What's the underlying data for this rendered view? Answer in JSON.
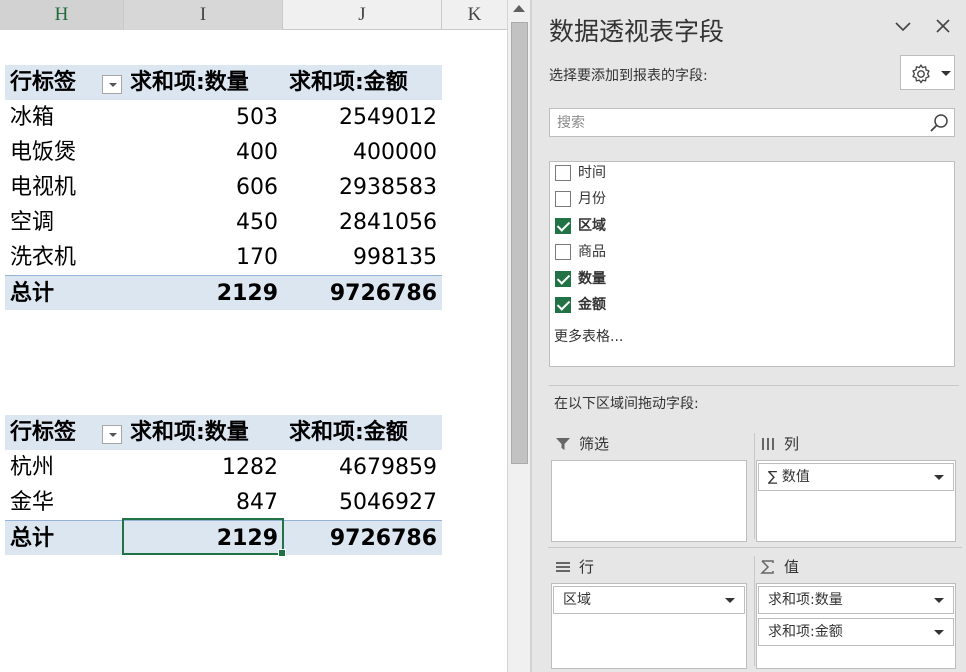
{
  "sheet": {
    "columns": [
      {
        "label": "H",
        "state": "normal"
      },
      {
        "label": "I",
        "state": "active"
      },
      {
        "label": "J",
        "state": "normal"
      },
      {
        "label": "K",
        "state": "normal"
      }
    ],
    "pivot1": {
      "headers": [
        "行标签",
        "求和项:数量",
        "求和项:金额"
      ],
      "rows": [
        [
          "冰箱",
          "503",
          "2549012"
        ],
        [
          "电饭煲",
          "400",
          "400000"
        ],
        [
          "电视机",
          "606",
          "2938583"
        ],
        [
          "空调",
          "450",
          "2841056"
        ],
        [
          "洗衣机",
          "170",
          "998135"
        ]
      ],
      "total": [
        "总计",
        "2129",
        "9726786"
      ]
    },
    "pivot2": {
      "headers": [
        "行标签",
        "求和项:数量",
        "求和项:金额"
      ],
      "rows": [
        [
          "杭州",
          "1282",
          "4679859"
        ],
        [
          "金华",
          "847",
          "5046927"
        ]
      ],
      "total": [
        "总计",
        "2129",
        "9726786"
      ]
    },
    "accent_color": "#217346",
    "header_fill": "#dce6f1"
  },
  "pane": {
    "title": "数据透视表字段",
    "choose_label": "选择要添加到报表的字段:",
    "search_placeholder": "搜索",
    "fields": [
      {
        "label": "时间",
        "checked": false
      },
      {
        "label": "月份",
        "checked": false
      },
      {
        "label": "区域",
        "checked": true
      },
      {
        "label": "商品",
        "checked": false
      },
      {
        "label": "数量",
        "checked": true
      },
      {
        "label": "金额",
        "checked": true
      }
    ],
    "more_tables": "更多表格...",
    "drag_label": "在以下区域间拖动字段:",
    "areas": {
      "filters": {
        "title": "筛选",
        "items": []
      },
      "columns": {
        "title": "列",
        "items": [
          "∑ 数值"
        ]
      },
      "rows": {
        "title": "行",
        "items": [
          "区域"
        ]
      },
      "values": {
        "title": "值",
        "items": [
          "求和项:数量",
          "求和项:金额"
        ]
      }
    }
  }
}
